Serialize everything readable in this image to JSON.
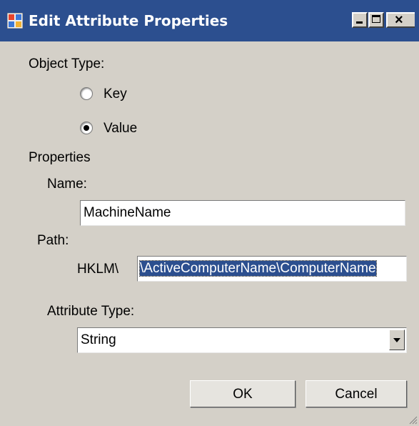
{
  "window": {
    "title": "Edit Attribute Properties",
    "close_glyph": "×"
  },
  "object_type": {
    "label": "Object Type:",
    "options": [
      {
        "label": "Key",
        "selected": false
      },
      {
        "label": "Value",
        "selected": true
      }
    ]
  },
  "properties": {
    "label": "Properties",
    "name": {
      "label": "Name:",
      "value": "MachineName"
    },
    "path": {
      "label": "Path:",
      "prefix": "HKLM\\",
      "value": "\\ActiveComputerName\\ComputerName"
    },
    "attribute_type": {
      "label": "Attribute Type:",
      "selected": "String"
    }
  },
  "buttons": {
    "ok": "OK",
    "cancel": "Cancel"
  },
  "colors": {
    "titlebar": "#2c4f8f",
    "dialog_bg": "#d4d0c8",
    "selection": "#2c4f8f"
  }
}
